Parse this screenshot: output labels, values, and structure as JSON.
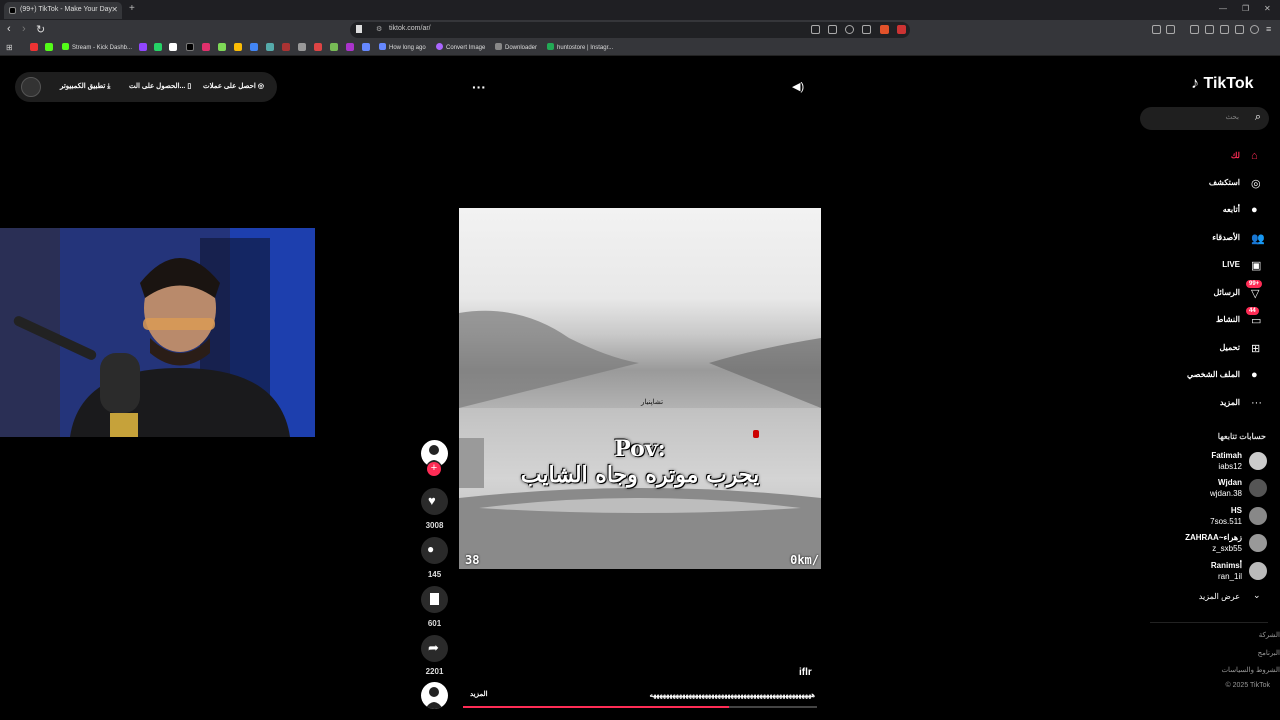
{
  "browser": {
    "tab_title": "(99+) TikTok - Make Your Day",
    "url": "tiktok.com/ar/",
    "bookmarks": [
      "Stream - Kick Dashb...",
      "How long ago",
      "Convert Image",
      "Downloader",
      "huntostore | Instagr..."
    ]
  },
  "top_pill": {
    "coins": "احصل على عملات",
    "get_app": "الحصول على الت...",
    "desktop_app": "تطبيق الكمبيوتر"
  },
  "video": {
    "overlay_title_line1": "Pov:",
    "overlay_title_line2": "يجرب موتره وجاه الشايب",
    "overlay_small": "تشاپنيار",
    "hud_left": "38",
    "hud_right": "0km/",
    "author": "iflr",
    "caption": "ههههههههههههههههههههههههههههههههههههههههههههههههههه",
    "caption_more": "المزيد",
    "progress": 0.75
  },
  "actions": {
    "likes": "3008",
    "comments": "145",
    "saves": "601",
    "shares": "2201"
  },
  "sidebar": {
    "logo": "TikTok",
    "search_placeholder": "بحث",
    "nav": [
      {
        "label": "لك",
        "icon": "home-icon"
      },
      {
        "label": "استكشف",
        "icon": "compass-icon"
      },
      {
        "label": "أتابعه",
        "icon": "following-icon"
      },
      {
        "label": "الأصدقاء",
        "icon": "friends-icon"
      },
      {
        "label": "LIVE",
        "icon": "live-icon"
      },
      {
        "label": "الرسائل",
        "icon": "messages-icon",
        "badge": "99+"
      },
      {
        "label": "النشاط",
        "icon": "activity-icon",
        "badge": "44"
      },
      {
        "label": "تحميل",
        "icon": "upload-icon"
      },
      {
        "label": "الملف الشخصي",
        "icon": "profile-icon"
      },
      {
        "label": "المزيد",
        "icon": "more-icon"
      }
    ],
    "following_title": "حسابات تتابعها",
    "accounts": [
      {
        "name": "Fatimah",
        "handle": "iabs12"
      },
      {
        "name": "Wjdan",
        "handle": "wjdan.38"
      },
      {
        "name": "HS",
        "handle": "7sos.511"
      },
      {
        "name": "ZAHRAA~زهراء",
        "handle": "z_sxb55"
      },
      {
        "name": "Ranimsأ",
        "handle": "ran_1il"
      }
    ],
    "see_more": "عرض المزيد",
    "footer": [
      "الشركة",
      "البرنامج",
      "الشروط والسياسات",
      "© 2025 TikTok"
    ]
  },
  "colors": {
    "accent": "#fe2c55",
    "bg": "#000000"
  }
}
